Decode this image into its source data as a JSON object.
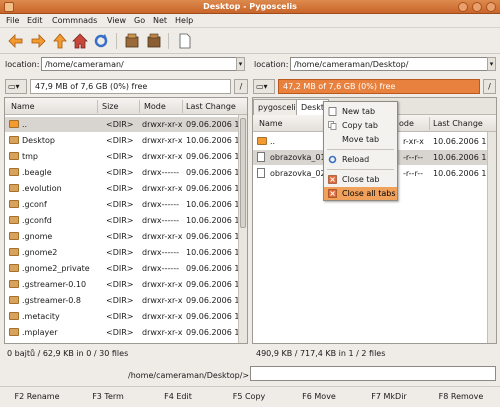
{
  "window": {
    "title": "Desktop - Pygoscelis"
  },
  "menu": [
    "File",
    "Edit",
    "Commnads",
    "View",
    "Go",
    "Net",
    "Help"
  ],
  "toolbar": {
    "icons": [
      "back-arrow-icon",
      "forward-arrow-icon",
      "up-arrow-icon",
      "home-icon",
      "refresh-icon",
      "package-icon",
      "package-icon",
      "new-document-icon"
    ]
  },
  "left": {
    "location_label": "location:",
    "location": "/home/cameraman/",
    "free": "47,9 MB of 7,6 GB (0%) free",
    "drive": "/",
    "columns": [
      "Name",
      "Size",
      "Mode",
      "Last Change"
    ],
    "rows": [
      {
        "name": "..",
        "size": "<DIR>",
        "mode": "drwxr-xr-x",
        "date": "09.06.2006 1"
      },
      {
        "name": "Desktop",
        "size": "<DIR>",
        "mode": "drwxr-xr-x",
        "date": "10.06.2006 1"
      },
      {
        "name": "tmp",
        "size": "<DIR>",
        "mode": "drwxr-xr-x",
        "date": "09.06.2006 1"
      },
      {
        "name": ".beagle",
        "size": "<DIR>",
        "mode": "drwx------",
        "date": "09.06.2006 1"
      },
      {
        "name": ".evolution",
        "size": "<DIR>",
        "mode": "drwxr-xr-x",
        "date": "09.06.2006 1"
      },
      {
        "name": ".gconf",
        "size": "<DIR>",
        "mode": "drwx------",
        "date": "10.06.2006 1"
      },
      {
        "name": ".gconfd",
        "size": "<DIR>",
        "mode": "drwx------",
        "date": "10.06.2006 1"
      },
      {
        "name": ".gnome",
        "size": "<DIR>",
        "mode": "drwxr-xr-x",
        "date": "09.06.2006 1"
      },
      {
        "name": ".gnome2",
        "size": "<DIR>",
        "mode": "drwx------",
        "date": "10.06.2006 1"
      },
      {
        "name": ".gnome2_private",
        "size": "<DIR>",
        "mode": "drwx------",
        "date": "09.06.2006 1"
      },
      {
        "name": ".gstreamer-0.10",
        "size": "<DIR>",
        "mode": "drwxr-xr-x",
        "date": "09.06.2006 1"
      },
      {
        "name": ".gstreamer-0.8",
        "size": "<DIR>",
        "mode": "drwxr-xr-x",
        "date": "09.06.2006 1"
      },
      {
        "name": ".metacity",
        "size": "<DIR>",
        "mode": "drwxr-xr-x",
        "date": "09.06.2006 1"
      },
      {
        "name": ".mplayer",
        "size": "<DIR>",
        "mode": "drwxr-xr-x",
        "date": "09.06.2006 1"
      }
    ],
    "status": "0 bajtů / 62,9 KB in 0 / 30 files"
  },
  "right": {
    "location_label": "location:",
    "location": "/home/cameraman/Desktop/",
    "free": "47,2 MB of 7,6 GB (0%) free",
    "drive": "/",
    "tabs": [
      "pygoscelis",
      "Deskt"
    ],
    "columns": [
      "Name",
      "ode",
      "Last Change"
    ],
    "rows": [
      {
        "name": "..",
        "mode": "r-xr-x",
        "date": "10.06.2006 1"
      },
      {
        "name": "obrazovka_01.p",
        "mode": "-r--r--",
        "date": "10.06.2006 1"
      },
      {
        "name": "obrazovka_02.p",
        "mode": "-r--r--",
        "date": "10.06.2006 1"
      }
    ],
    "status": "490,9 KB / 717,4 KB in 1 / 2 files"
  },
  "context_menu": {
    "items": [
      {
        "label": "New tab",
        "icon": "new-tab-icon"
      },
      {
        "label": "Copy tab",
        "icon": "copy-tab-icon"
      },
      {
        "label": "Move tab",
        "icon": ""
      },
      {
        "label": "Reload",
        "icon": "reload-icon"
      },
      {
        "label": "Close tab",
        "icon": "close-tab-icon"
      },
      {
        "label": "Close all tabs",
        "icon": "close-all-tabs-icon"
      }
    ],
    "highlighted": "Close all tabs"
  },
  "command": {
    "prompt": "/home/cameraman/Desktop/>",
    "value": ""
  },
  "fkeys": [
    "F2 Rename",
    "F3 Term",
    "F4 Edit",
    "F5 Copy",
    "F6 Move",
    "F7 MkDir",
    "F8 Remove"
  ],
  "colors": {
    "accent": "#e27a34",
    "free_bar": "#e8803e",
    "selection": "#d8d5d0",
    "menu_highlight": "#f0a25c"
  }
}
